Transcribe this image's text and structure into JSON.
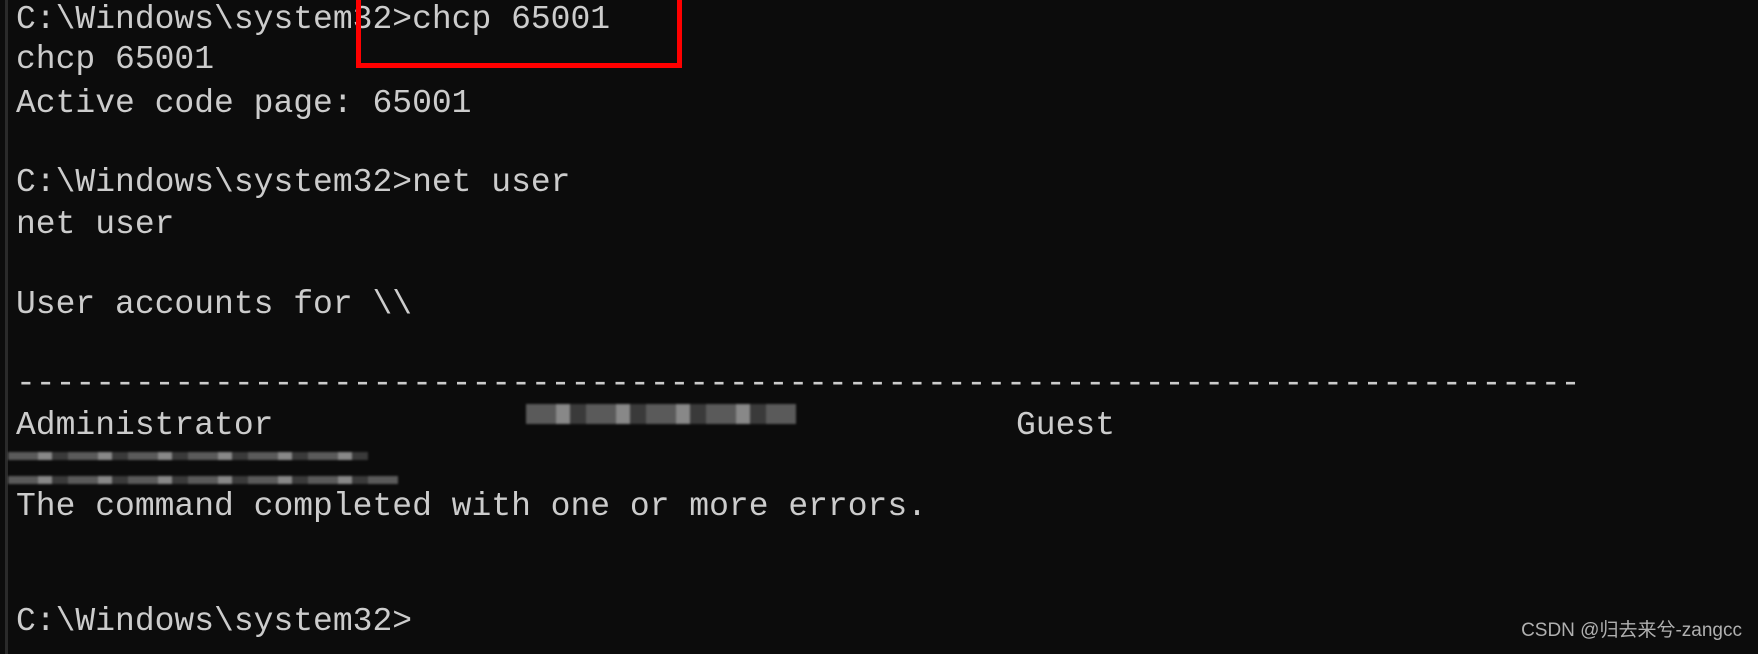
{
  "terminal": {
    "lines": [
      "C:\\Windows\\system32>chcp 65001",
      "chcp 65001",
      "Active code page: 65001",
      "",
      "C:\\Windows\\system32>net user",
      "net user",
      "",
      "User accounts for \\\\",
      "",
      "-------------------------------------------------------------------------------",
      "Administrator",
      "",
      "The command completed with one or more errors.",
      "",
      "",
      "C:\\Windows\\system32>"
    ],
    "guest_account": "Guest"
  },
  "annotation": {
    "highlight_color": "#ff0000"
  },
  "watermark": "CSDN @归去来兮-zangcc",
  "colors": {
    "background": "#0c0c0c",
    "text": "#cccccc"
  }
}
